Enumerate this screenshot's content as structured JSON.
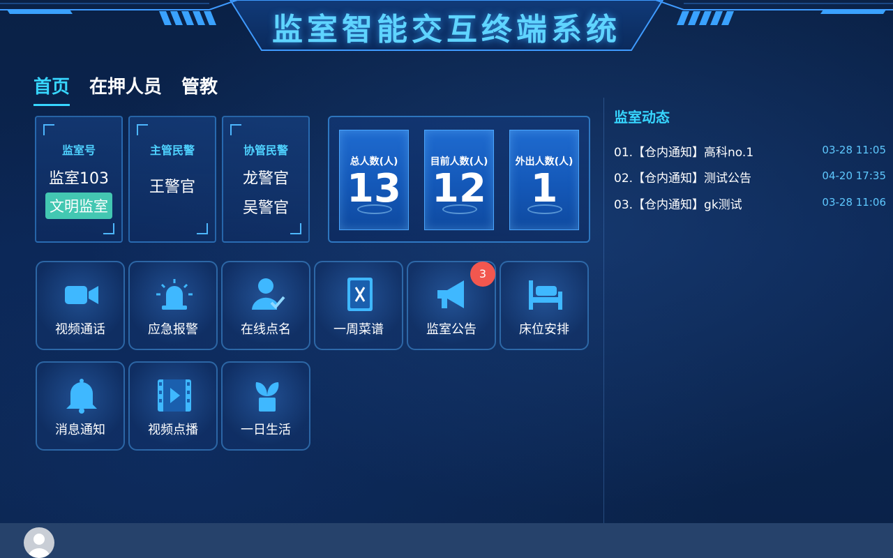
{
  "app_title": "监室智能交互终端系统",
  "tabs": [
    {
      "label": "首页",
      "active": true
    },
    {
      "label": "在押人员",
      "active": false
    },
    {
      "label": "管教",
      "active": false
    }
  ],
  "info_cards": {
    "room": {
      "label": "监室号",
      "value": "监室103",
      "badge": "文明监室"
    },
    "chief": {
      "label": "主管民警",
      "value": "王警官"
    },
    "assist": {
      "label": "协管民警",
      "values": [
        "龙警官",
        "吴警官"
      ]
    }
  },
  "stats": [
    {
      "label": "总人数(人)",
      "value": "13"
    },
    {
      "label": "目前人数(人)",
      "value": "12"
    },
    {
      "label": "外出人数(人)",
      "value": "1"
    }
  ],
  "apps": [
    {
      "label": "视频通话",
      "icon": "video-camera-icon"
    },
    {
      "label": "应急报警",
      "icon": "alarm-light-icon"
    },
    {
      "label": "在线点名",
      "icon": "user-check-icon"
    },
    {
      "label": "一周菜谱",
      "icon": "recipe-book-icon"
    },
    {
      "label": "监室公告",
      "icon": "megaphone-icon",
      "badge": "3"
    },
    {
      "label": "床位安排",
      "icon": "bed-icon"
    },
    {
      "label": "消息通知",
      "icon": "bell-icon"
    },
    {
      "label": "视频点播",
      "icon": "film-icon"
    },
    {
      "label": "一日生活",
      "icon": "plant-icon"
    }
  ],
  "news": {
    "title": "监室动态",
    "items": [
      {
        "text": "01.【仓内通知】高科no.1",
        "date": "03-28 11:05"
      },
      {
        "text": "02.【仓内通知】测试公告",
        "date": "04-20 17:35"
      },
      {
        "text": "03.【仓内通知】gk测试",
        "date": "03-28 11:06"
      }
    ]
  },
  "colors": {
    "accent": "#37d6ff",
    "badge_red": "#f2574f",
    "badge_green": "#43c7b2",
    "icon_blue": "#3fb8ff",
    "footer": "#26426b"
  }
}
